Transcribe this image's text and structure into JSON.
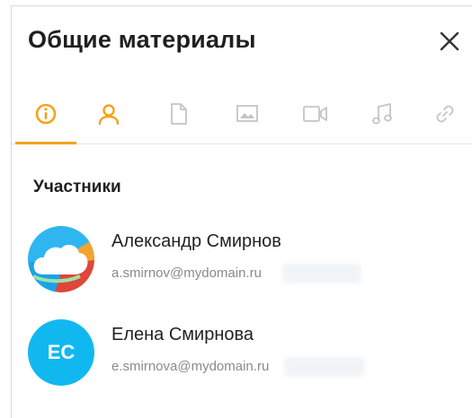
{
  "panel": {
    "title": "Общие материалы",
    "close_icon": "close-icon"
  },
  "tabs": [
    {
      "name": "info",
      "icon": "info-icon",
      "active": true
    },
    {
      "name": "members",
      "icon": "user-icon",
      "active": false
    },
    {
      "name": "files",
      "icon": "file-icon",
      "active": false
    },
    {
      "name": "images",
      "icon": "image-icon",
      "active": false
    },
    {
      "name": "videos",
      "icon": "video-icon",
      "active": false
    },
    {
      "name": "audio",
      "icon": "music-icon",
      "active": false
    },
    {
      "name": "links",
      "icon": "link-icon",
      "active": false
    }
  ],
  "colors": {
    "accent": "#f5a31a",
    "inactive_icon": "#c4c4c4",
    "avatar_ec": "#11b8f0"
  },
  "members_section": {
    "title": "Участники",
    "items": [
      {
        "name": "Александр Смирнов",
        "email": "a.smirnov@mydomain.ru",
        "avatar_type": "cloud-logo"
      },
      {
        "name": "Елена Смирнова",
        "email": "e.smirnova@mydomain.ru",
        "avatar_initials": "EC"
      }
    ]
  }
}
